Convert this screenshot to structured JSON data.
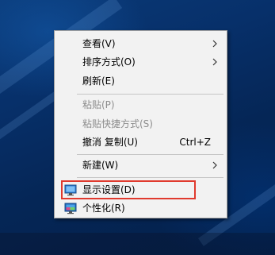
{
  "menu": {
    "view": "查看(V)",
    "sort_by": "排序方式(O)",
    "refresh": "刷新(E)",
    "paste": "粘贴(P)",
    "paste_shortcut": "粘贴快捷方式(S)",
    "undo_copy": "撤消 复制(U)",
    "undo_copy_shortcut": "Ctrl+Z",
    "new": "新建(W)",
    "display_settings": "显示设置(D)",
    "personalize": "个性化(R)"
  },
  "icons": {
    "display_settings": "monitor-icon",
    "personalize": "personalize-icon",
    "submenu": "chevron-right-icon"
  },
  "colors": {
    "desktop_background": "#062a5e",
    "menu_background": "#f2f2f2",
    "disabled_text": "#8d8d8d",
    "highlight_border": "#e03a2e"
  }
}
